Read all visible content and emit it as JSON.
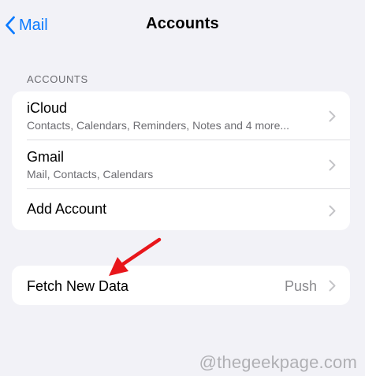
{
  "nav": {
    "back_label": "Mail",
    "title": "Accounts"
  },
  "accounts_section": {
    "header": "ACCOUNTS",
    "items": [
      {
        "title": "iCloud",
        "subtitle": "Contacts, Calendars, Reminders, Notes and 4 more..."
      },
      {
        "title": "Gmail",
        "subtitle": "Mail, Contacts, Calendars"
      },
      {
        "title": "Add Account"
      }
    ]
  },
  "fetch": {
    "label": "Fetch New Data",
    "value": "Push"
  },
  "annotation": {
    "arrow_color": "#e8161b"
  },
  "watermark": "@thegeekpage.com",
  "colors": {
    "accent": "#0a7aff",
    "background": "#f2f2f7",
    "secondary_text": "#6d6d72"
  }
}
